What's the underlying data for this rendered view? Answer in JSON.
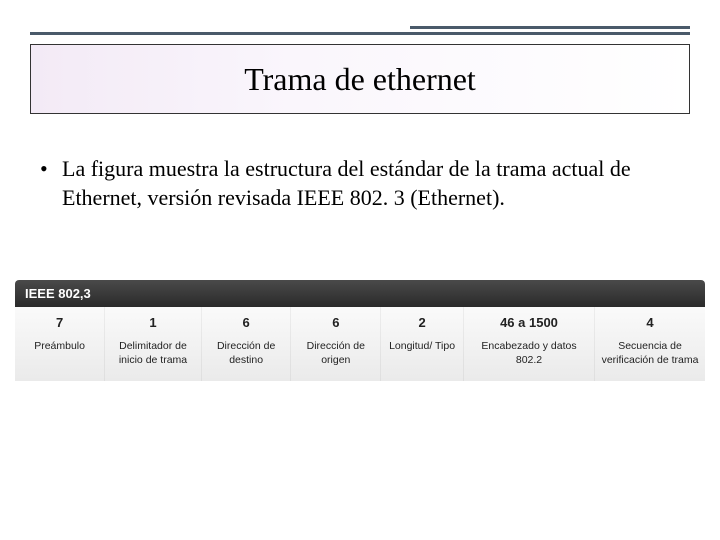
{
  "title": "Trama de ethernet",
  "bullet": "La figura muestra la estructura del estándar de la trama actual de Ethernet, versión revisada IEEE 802. 3 (Ethernet).",
  "frame": {
    "header": "IEEE 802,3",
    "fields": [
      {
        "bytes": "7",
        "label": "Preámbulo"
      },
      {
        "bytes": "1",
        "label": "Delimitador de inicio de trama"
      },
      {
        "bytes": "6",
        "label": "Dirección de destino"
      },
      {
        "bytes": "6",
        "label": "Dirección de origen"
      },
      {
        "bytes": "2",
        "label": "Longitud/ Tipo"
      },
      {
        "bytes": "46 a 1500",
        "label": "Encabezado y datos 802.2"
      },
      {
        "bytes": "4",
        "label": "Secuencia de verificación de trama"
      }
    ]
  }
}
